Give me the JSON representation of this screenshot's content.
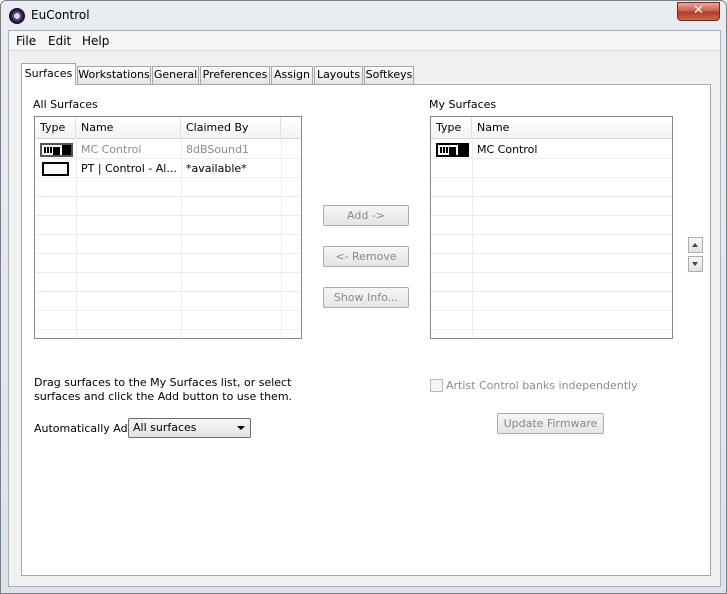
{
  "window": {
    "title": "EuControl",
    "close_glyph": "✕"
  },
  "menu": {
    "items": [
      "File",
      "Edit",
      "Help"
    ]
  },
  "tabs": [
    "Surfaces",
    "Workstations",
    "General",
    "Preferences",
    "Assign",
    "Layouts",
    "Softkeys"
  ],
  "active_tab": "Surfaces",
  "all_surfaces": {
    "title": "All Surfaces",
    "columns": [
      "Type",
      "Name",
      "Claimed By"
    ],
    "rows": [
      {
        "icon": "control-surface-icon",
        "name": "MC Control",
        "claimed_by": "8dBSound1",
        "disabled": true
      },
      {
        "icon": "blank-surface-icon",
        "name": "PT | Control - Al...",
        "claimed_by": "*available*",
        "disabled": false
      }
    ],
    "hint": "Drag surfaces to the My Surfaces list, or select surfaces and click the Add button to use them."
  },
  "buttons": {
    "add": "Add  ->",
    "remove": "<- Remove",
    "show_info": "Show Info...",
    "update_firmware": "Update Firmware"
  },
  "my_surfaces": {
    "title": "My Surfaces",
    "columns": [
      "Type",
      "Name"
    ],
    "rows": [
      {
        "icon": "control-surface-icon",
        "name": "MC Control"
      }
    ],
    "artist_control_label": "Artist Control banks independently",
    "artist_control_checked": false
  },
  "auto_add": {
    "label": "Automatically Add:",
    "value": "All surfaces"
  },
  "colors": {
    "disabled_text": "#8c8c8c",
    "close_button": "#c75a45"
  }
}
